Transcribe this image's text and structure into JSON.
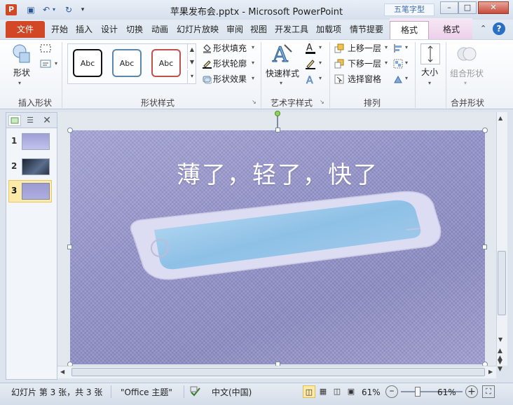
{
  "titlebar": {
    "app_icon": "P",
    "title": "苹果发布会.pptx - Microsoft PowerPoint",
    "watermark": "五笔字型"
  },
  "tabs": {
    "file": "文件",
    "items": [
      "开始",
      "插入",
      "设计",
      "切换",
      "动画",
      "幻灯片放映",
      "审阅",
      "视图",
      "开发工具",
      "加载项",
      "情节提要"
    ],
    "format1": "格式",
    "format2": "格式"
  },
  "ribbon": {
    "insert_shape": {
      "shape_btn": "形状",
      "label": "插入形状"
    },
    "shape_styles": {
      "gallery": [
        {
          "text": "Abc",
          "color": "#111111"
        },
        {
          "text": "Abc",
          "color": "#5b86ad"
        },
        {
          "text": "Abc",
          "color": "#c0504d"
        }
      ],
      "fill": "形状填充",
      "outline": "形状轮廓",
      "effects": "形状效果",
      "label": "形状样式"
    },
    "wordart": {
      "quick_styles": "快速样式",
      "label": "艺术字样式"
    },
    "arrange": {
      "bring_forward": "上移一层",
      "send_backward": "下移一层",
      "selection_pane": "选择窗格",
      "label": "排列"
    },
    "size": {
      "size_btn": "大小"
    },
    "merge": {
      "merge_btn": "组合形状",
      "label": "合并形状"
    }
  },
  "slides": {
    "numbers": [
      "1",
      "2",
      "3"
    ],
    "selected": 3
  },
  "slide": {
    "title": "薄了，轻了，快了"
  },
  "statusbar": {
    "slide_info": "幻灯片 第 3 张，共 3 张",
    "theme": "\"Office 主题\"",
    "language": "中文(中国)",
    "zoom_pct": "61%",
    "zoom_pct2": "61%"
  }
}
